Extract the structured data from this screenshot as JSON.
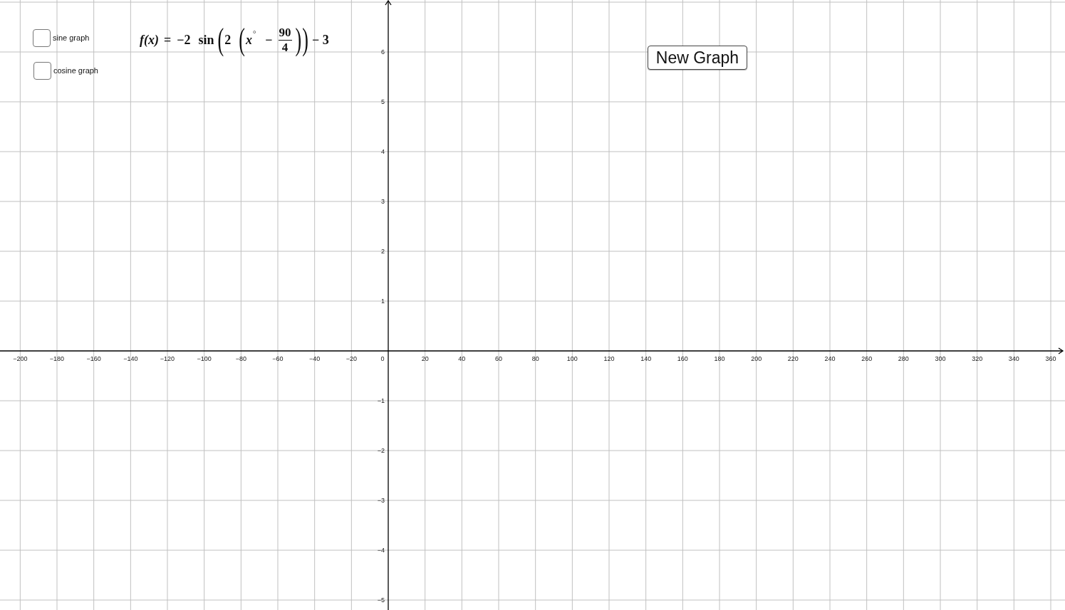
{
  "controls": [
    {
      "label": "sine graph",
      "checked": false
    },
    {
      "label": "cosine graph",
      "checked": false
    }
  ],
  "formula": {
    "lhs": "f(x)",
    "equals": "=",
    "amplitude": "−2",
    "function": "sin",
    "open_paren": "(",
    "coefficient": "2",
    "variable": "x",
    "degree": "°",
    "minus": "−",
    "numerator": "90",
    "denominator": "4",
    "close_paren": ")",
    "shift": "− 3"
  },
  "button": {
    "label": "New Graph"
  },
  "graph": {
    "x_labels": [
      "−200",
      "−180",
      "−160",
      "−140",
      "−120",
      "−100",
      "−80",
      "−60",
      "−40",
      "−20",
      "0",
      "20",
      "40",
      "60",
      "80",
      "100",
      "120",
      "140",
      "160",
      "180",
      "200",
      "220",
      "240",
      "260",
      "280",
      "300",
      "320",
      "340",
      "360"
    ],
    "y_labels": [
      "6",
      "5",
      "4",
      "3",
      "2",
      "1",
      "−1",
      "−2",
      "−3",
      "−4",
      "−5"
    ]
  }
}
